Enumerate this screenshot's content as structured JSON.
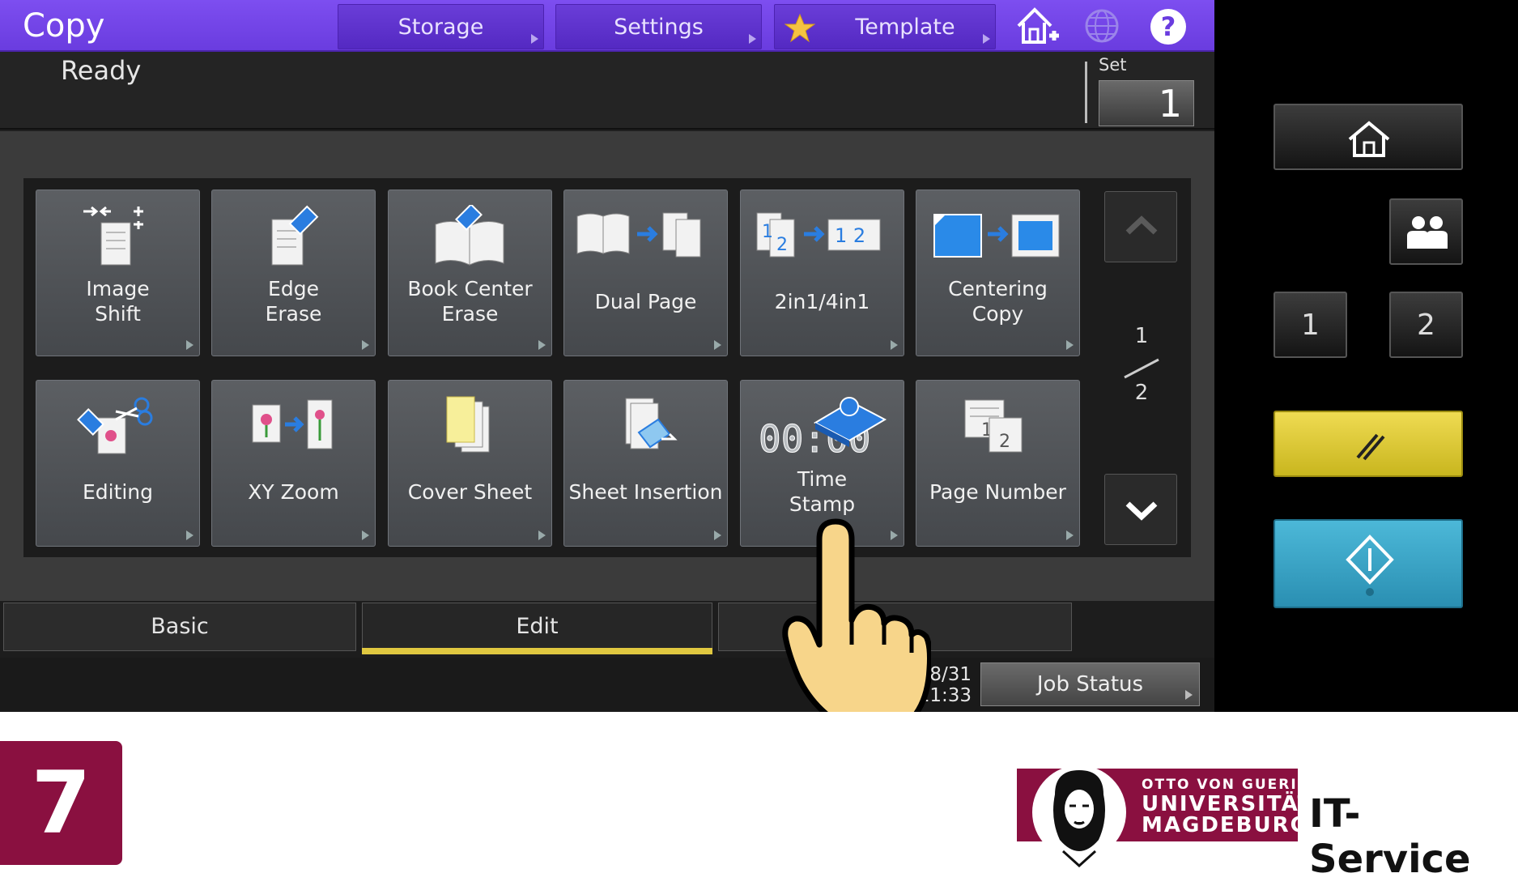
{
  "header": {
    "title": "Copy",
    "storage_label": "Storage",
    "settings_label": "Settings",
    "template_label": "Template"
  },
  "status": {
    "text": "Ready",
    "set_label": "Set",
    "set_value": "1"
  },
  "functions": [
    {
      "label": "Image\nShift",
      "icon": "image-shift-icon"
    },
    {
      "label": "Edge\nErase",
      "icon": "edge-erase-icon"
    },
    {
      "label": "Book Center\nErase",
      "icon": "book-center-erase-icon"
    },
    {
      "label": "Dual Page",
      "icon": "dual-page-icon"
    },
    {
      "label": "2in1/4in1",
      "icon": "2in1-4in1-icon"
    },
    {
      "label": "Centering\nCopy",
      "icon": "centering-copy-icon"
    },
    {
      "label": "Editing",
      "icon": "editing-icon"
    },
    {
      "label": "XY Zoom",
      "icon": "xy-zoom-icon"
    },
    {
      "label": "Cover Sheet",
      "icon": "cover-sheet-icon"
    },
    {
      "label": "Sheet Insertion",
      "icon": "sheet-insertion-icon"
    },
    {
      "label": "Time\nStamp",
      "icon": "time-stamp-icon"
    },
    {
      "label": "Page Number",
      "icon": "page-number-icon"
    }
  ],
  "pager": {
    "current": "1",
    "total": "2"
  },
  "tabs": [
    {
      "label": "Basic"
    },
    {
      "label": "Edit"
    }
  ],
  "footer_bar": {
    "date": ")8/31",
    "time": "11:33",
    "job_status_label": "Job Status"
  },
  "hardware": {
    "btn1": "1",
    "btn2": "2"
  },
  "caption": {
    "step_number": "7",
    "logo_line1": "OTTO VON GUERICKE",
    "logo_line2": "UNIVERSITÄT",
    "logo_line3": "MAGDEBURG",
    "service_name": "IT-Service"
  },
  "colors": {
    "topbar": "#7d4ef0",
    "active_tab_underline": "#e0c840",
    "reset_button": "#e3cf3a",
    "start_button": "#3aa7c8",
    "brand": "#8a1040"
  }
}
